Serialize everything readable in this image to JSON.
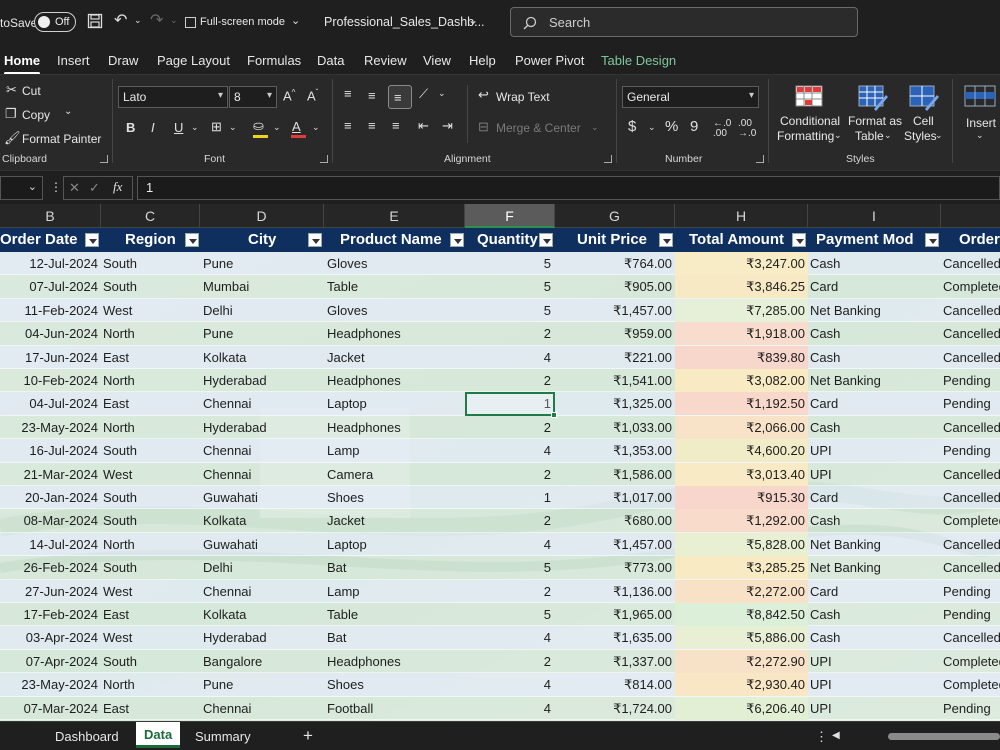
{
  "titlebar": {
    "autosave_label": "toSave",
    "autosave_state": "Off",
    "fullscreen_label": "Full-screen mode",
    "file_name": "Professional_Sales_Dashb...",
    "search_placeholder": "Search"
  },
  "ribbon_tabs": [
    "Home",
    "Insert",
    "Draw",
    "Page Layout",
    "Formulas",
    "Data",
    "Review",
    "View",
    "Help",
    "Power Pivot",
    "Table Design"
  ],
  "ribbon": {
    "clipboard": {
      "cut": "Cut",
      "copy": "Copy",
      "format_painter": "Format Painter",
      "label": "Clipboard"
    },
    "font": {
      "name": "Lato",
      "size": "8",
      "label": "Font"
    },
    "alignment": {
      "wrap_text": "Wrap Text",
      "merge_center": "Merge & Center",
      "label": "Alignment"
    },
    "number": {
      "format": "General",
      "label": "Number"
    },
    "styles": {
      "conditional": "Conditional",
      "formatting": "Formatting",
      "format_as": "Format as",
      "table": "Table",
      "cell": "Cell",
      "styles_btn": "Styles",
      "label": "Styles"
    },
    "cells": {
      "insert": "Insert"
    }
  },
  "formula_bar": {
    "value": "1"
  },
  "columns": [
    "B",
    "C",
    "D",
    "E",
    "F",
    "G",
    "H",
    "I"
  ],
  "table": {
    "headers": [
      "Order Date",
      "Region",
      "City",
      "Product Name",
      "Quantity",
      "Unit Price",
      "Total Amount",
      "Payment Mod",
      "Order"
    ],
    "rows": [
      [
        "12-Jul-2024",
        "South",
        "Pune",
        "Gloves",
        "5",
        "₹764.00",
        "₹3,247.00",
        "Cash",
        "Cancelled"
      ],
      [
        "07-Jul-2024",
        "South",
        "Mumbai",
        "Table",
        "5",
        "₹905.00",
        "₹3,846.25",
        "Card",
        "Completed"
      ],
      [
        "11-Feb-2024",
        "West",
        "Delhi",
        "Gloves",
        "5",
        "₹1,457.00",
        "₹7,285.00",
        "Net Banking",
        "Cancelled"
      ],
      [
        "04-Jun-2024",
        "North",
        "Pune",
        "Headphones",
        "2",
        "₹959.00",
        "₹1,918.00",
        "Cash",
        "Cancelled"
      ],
      [
        "17-Jun-2024",
        "East",
        "Kolkata",
        "Jacket",
        "4",
        "₹221.00",
        "₹839.80",
        "Cash",
        "Cancelled"
      ],
      [
        "10-Feb-2024",
        "North",
        "Hyderabad",
        "Headphones",
        "2",
        "₹1,541.00",
        "₹3,082.00",
        "Net Banking",
        "Pending"
      ],
      [
        "04-Jul-2024",
        "East",
        "Chennai",
        "Laptop",
        "1",
        "₹1,325.00",
        "₹1,192.50",
        "Card",
        "Pending"
      ],
      [
        "23-May-2024",
        "North",
        "Hyderabad",
        "Headphones",
        "2",
        "₹1,033.00",
        "₹2,066.00",
        "Cash",
        "Cancelled"
      ],
      [
        "16-Jul-2024",
        "South",
        "Chennai",
        "Lamp",
        "4",
        "₹1,353.00",
        "₹4,600.20",
        "UPI",
        "Pending"
      ],
      [
        "21-Mar-2024",
        "West",
        "Chennai",
        "Camera",
        "2",
        "₹1,586.00",
        "₹3,013.40",
        "UPI",
        "Cancelled"
      ],
      [
        "20-Jan-2024",
        "South",
        "Guwahati",
        "Shoes",
        "1",
        "₹1,017.00",
        "₹915.30",
        "Card",
        "Cancelled"
      ],
      [
        "08-Mar-2024",
        "South",
        "Kolkata",
        "Jacket",
        "2",
        "₹680.00",
        "₹1,292.00",
        "Cash",
        "Completed"
      ],
      [
        "14-Jul-2024",
        "North",
        "Guwahati",
        "Laptop",
        "4",
        "₹1,457.00",
        "₹5,828.00",
        "Net Banking",
        "Cancelled"
      ],
      [
        "26-Feb-2024",
        "South",
        "Delhi",
        "Bat",
        "5",
        "₹773.00",
        "₹3,285.25",
        "Net Banking",
        "Cancelled"
      ],
      [
        "27-Jun-2024",
        "West",
        "Chennai",
        "Lamp",
        "2",
        "₹1,136.00",
        "₹2,272.00",
        "Card",
        "Pending"
      ],
      [
        "17-Feb-2024",
        "East",
        "Kolkata",
        "Table",
        "5",
        "₹1,965.00",
        "₹8,842.50",
        "Cash",
        "Pending"
      ],
      [
        "03-Apr-2024",
        "West",
        "Hyderabad",
        "Bat",
        "4",
        "₹1,635.00",
        "₹5,886.00",
        "Cash",
        "Cancelled"
      ],
      [
        "07-Apr-2024",
        "South",
        "Bangalore",
        "Headphones",
        "2",
        "₹1,337.00",
        "₹2,272.90",
        "UPI",
        "Completed"
      ],
      [
        "23-May-2024",
        "North",
        "Pune",
        "Shoes",
        "4",
        "₹814.00",
        "₹2,930.40",
        "UPI",
        "Completed"
      ],
      [
        "07-Mar-2024",
        "East",
        "Chennai",
        "Football",
        "4",
        "₹1,724.00",
        "₹6,206.40",
        "UPI",
        "Pending"
      ]
    ],
    "amount_colors": [
      "#f7ecc6",
      "#f7e9c4",
      "#e6f0d8",
      "#f8dccd",
      "#f7d6cc",
      "#f8eac3",
      "#f8d8cb",
      "#f8e3c8",
      "#f0ecc8",
      "#f8eac4",
      "#f8d6cc",
      "#f8dbcb",
      "#e9efd2",
      "#f8ebc4",
      "#f8e2c7",
      "#dcefd8",
      "#e8efd4",
      "#f8e2c7",
      "#f8e6c5",
      "#e3efd5"
    ]
  },
  "sheet_tabs": [
    "Dashboard",
    "Data",
    "Summary"
  ],
  "sheet_add": "+"
}
